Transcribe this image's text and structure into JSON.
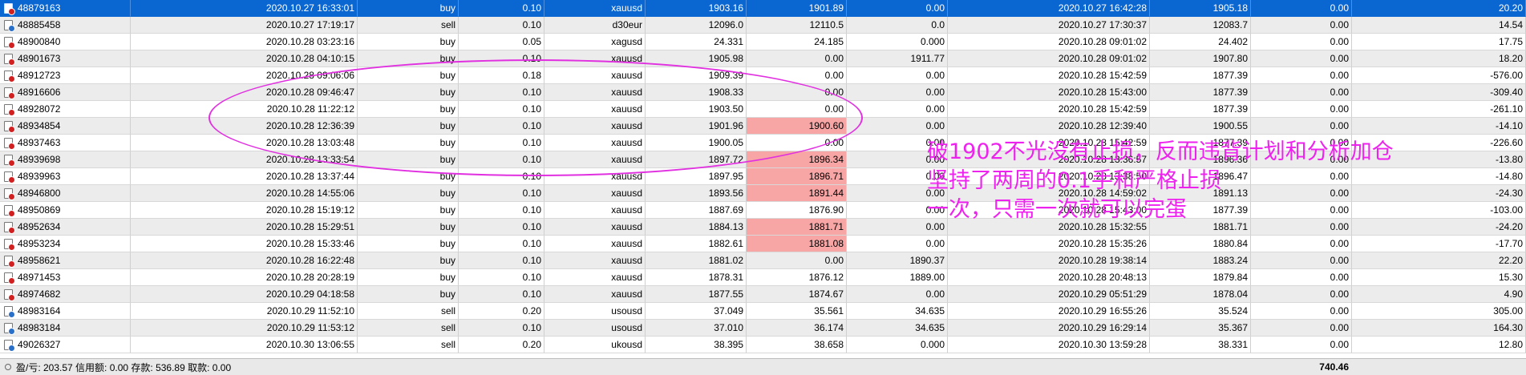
{
  "rows": [
    {
      "ticket": "48879163",
      "open_time": "2020.10.27 16:33:01",
      "type": "buy",
      "lots": "0.10",
      "symbol": "xauusd",
      "open_price": "1903.16",
      "sl": "1901.89",
      "tp": "0.00",
      "close_time": "2020.10.27 16:42:28",
      "close_price": "1905.18",
      "swap": "0.00",
      "profit": "20.20",
      "selected": true
    },
    {
      "ticket": "48885458",
      "open_time": "2020.10.27 17:19:17",
      "type": "sell",
      "lots": "0.10",
      "symbol": "d30eur",
      "open_price": "12096.0",
      "sl": "12110.5",
      "tp": "0.0",
      "close_time": "2020.10.27 17:30:37",
      "close_price": "12083.7",
      "swap": "0.00",
      "profit": "14.54"
    },
    {
      "ticket": "48900840",
      "open_time": "2020.10.28 03:23:16",
      "type": "buy",
      "lots": "0.05",
      "symbol": "xagusd",
      "open_price": "24.331",
      "sl": "24.185",
      "tp": "0.000",
      "close_time": "2020.10.28 09:01:02",
      "close_price": "24.402",
      "swap": "0.00",
      "profit": "17.75"
    },
    {
      "ticket": "48901673",
      "open_time": "2020.10.28 04:10:15",
      "type": "buy",
      "lots": "0.10",
      "symbol": "xauusd",
      "open_price": "1905.98",
      "sl": "0.00",
      "tp": "1911.77",
      "close_time": "2020.10.28 09:01:02",
      "close_price": "1907.80",
      "swap": "0.00",
      "profit": "18.20"
    },
    {
      "ticket": "48912723",
      "open_time": "2020.10.28 09:06:06",
      "type": "buy",
      "lots": "0.18",
      "symbol": "xauusd",
      "open_price": "1909.39",
      "sl": "0.00",
      "tp": "0.00",
      "close_time": "2020.10.28 15:42:59",
      "close_price": "1877.39",
      "swap": "0.00",
      "profit": "-576.00"
    },
    {
      "ticket": "48916606",
      "open_time": "2020.10.28 09:46:47",
      "type": "buy",
      "lots": "0.10",
      "symbol": "xauusd",
      "open_price": "1908.33",
      "sl": "0.00",
      "tp": "0.00",
      "close_time": "2020.10.28 15:43:00",
      "close_price": "1877.39",
      "swap": "0.00",
      "profit": "-309.40"
    },
    {
      "ticket": "48928072",
      "open_time": "2020.10.28 11:22:12",
      "type": "buy",
      "lots": "0.10",
      "symbol": "xauusd",
      "open_price": "1903.50",
      "sl": "0.00",
      "tp": "0.00",
      "close_time": "2020.10.28 15:42:59",
      "close_price": "1877.39",
      "swap": "0.00",
      "profit": "-261.10"
    },
    {
      "ticket": "48934854",
      "open_time": "2020.10.28 12:36:39",
      "type": "buy",
      "lots": "0.10",
      "symbol": "xauusd",
      "open_price": "1901.96",
      "sl": "1900.60",
      "tp": "0.00",
      "close_time": "2020.10.28 12:39:40",
      "close_price": "1900.55",
      "swap": "0.00",
      "profit": "-14.10",
      "sl_highlight": true
    },
    {
      "ticket": "48937463",
      "open_time": "2020.10.28 13:03:48",
      "type": "buy",
      "lots": "0.10",
      "symbol": "xauusd",
      "open_price": "1900.05",
      "sl": "0.00",
      "tp": "0.00",
      "close_time": "2020.10.28 15:42:59",
      "close_price": "1877.39",
      "swap": "0.00",
      "profit": "-226.60"
    },
    {
      "ticket": "48939698",
      "open_time": "2020.10.28 13:33:54",
      "type": "buy",
      "lots": "0.10",
      "symbol": "xauusd",
      "open_price": "1897.72",
      "sl": "1896.34",
      "tp": "0.00",
      "close_time": "2020.10.28 13:36:57",
      "close_price": "1896.36",
      "swap": "0.00",
      "profit": "-13.80",
      "sl_highlight": true
    },
    {
      "ticket": "48939963",
      "open_time": "2020.10.28 13:37:44",
      "type": "buy",
      "lots": "0.10",
      "symbol": "xauusd",
      "open_price": "1897.95",
      "sl": "1896.71",
      "tp": "0.00",
      "close_time": "2020.10.28 13:38:50",
      "close_price": "1896.47",
      "swap": "0.00",
      "profit": "-14.80",
      "sl_highlight": true
    },
    {
      "ticket": "48946800",
      "open_time": "2020.10.28 14:55:06",
      "type": "buy",
      "lots": "0.10",
      "symbol": "xauusd",
      "open_price": "1893.56",
      "sl": "1891.44",
      "tp": "0.00",
      "close_time": "2020.10.28 14:59:02",
      "close_price": "1891.13",
      "swap": "0.00",
      "profit": "-24.30",
      "sl_highlight": true
    },
    {
      "ticket": "48950869",
      "open_time": "2020.10.28 15:19:12",
      "type": "buy",
      "lots": "0.10",
      "symbol": "xauusd",
      "open_price": "1887.69",
      "sl": "1876.90",
      "tp": "0.00",
      "close_time": "2020.10.28 15:43:00",
      "close_price": "1877.39",
      "swap": "0.00",
      "profit": "-103.00"
    },
    {
      "ticket": "48952634",
      "open_time": "2020.10.28 15:29:51",
      "type": "buy",
      "lots": "0.10",
      "symbol": "xauusd",
      "open_price": "1884.13",
      "sl": "1881.71",
      "tp": "0.00",
      "close_time": "2020.10.28 15:32:55",
      "close_price": "1881.71",
      "swap": "0.00",
      "profit": "-24.20",
      "sl_highlight": true
    },
    {
      "ticket": "48953234",
      "open_time": "2020.10.28 15:33:46",
      "type": "buy",
      "lots": "0.10",
      "symbol": "xauusd",
      "open_price": "1882.61",
      "sl": "1881.08",
      "tp": "0.00",
      "close_time": "2020.10.28 15:35:26",
      "close_price": "1880.84",
      "swap": "0.00",
      "profit": "-17.70",
      "sl_highlight": true
    },
    {
      "ticket": "48958621",
      "open_time": "2020.10.28 16:22:48",
      "type": "buy",
      "lots": "0.10",
      "symbol": "xauusd",
      "open_price": "1881.02",
      "sl": "0.00",
      "tp": "1890.37",
      "close_time": "2020.10.28 19:38:14",
      "close_price": "1883.24",
      "swap": "0.00",
      "profit": "22.20"
    },
    {
      "ticket": "48971453",
      "open_time": "2020.10.28 20:28:19",
      "type": "buy",
      "lots": "0.10",
      "symbol": "xauusd",
      "open_price": "1878.31",
      "sl": "1876.12",
      "tp": "1889.00",
      "close_time": "2020.10.28 20:48:13",
      "close_price": "1879.84",
      "swap": "0.00",
      "profit": "15.30"
    },
    {
      "ticket": "48974682",
      "open_time": "2020.10.29 04:18:58",
      "type": "buy",
      "lots": "0.10",
      "symbol": "xauusd",
      "open_price": "1877.55",
      "sl": "1874.67",
      "tp": "0.00",
      "close_time": "2020.10.29 05:51:29",
      "close_price": "1878.04",
      "swap": "0.00",
      "profit": "4.90"
    },
    {
      "ticket": "48983164",
      "open_time": "2020.10.29 11:52:10",
      "type": "sell",
      "lots": "0.20",
      "symbol": "usousd",
      "open_price": "37.049",
      "sl": "35.561",
      "tp": "34.635",
      "close_time": "2020.10.29 16:55:26",
      "close_price": "35.524",
      "swap": "0.00",
      "profit": "305.00"
    },
    {
      "ticket": "48983184",
      "open_time": "2020.10.29 11:53:12",
      "type": "sell",
      "lots": "0.10",
      "symbol": "usousd",
      "open_price": "37.010",
      "sl": "36.174",
      "tp": "34.635",
      "close_time": "2020.10.29 16:29:14",
      "close_price": "35.367",
      "swap": "0.00",
      "profit": "164.30"
    },
    {
      "ticket": "49026327",
      "open_time": "2020.10.30 13:06:55",
      "type": "sell",
      "lots": "0.20",
      "symbol": "ukousd",
      "open_price": "38.395",
      "sl": "38.658",
      "tp": "0.000",
      "close_time": "2020.10.30 13:59:28",
      "close_price": "38.331",
      "swap": "0.00",
      "profit": "12.80"
    }
  ],
  "status_bar": {
    "summary": "盈/亏: 203.57  信用额: 0.00  存款: 536.89  取款: 0.00",
    "total": "740.46"
  },
  "annotation": {
    "line1": "破1902不光没有止损，反而违背计划和分析加仓",
    "line2": "坚持了两周的0.1手和严格止损",
    "line3": "一次，只需一次就可以完蛋"
  },
  "colors": {
    "selected_row": "#0a66d0",
    "sl_highlight": "#f7a5a5",
    "annotation": "#ee22ee"
  }
}
